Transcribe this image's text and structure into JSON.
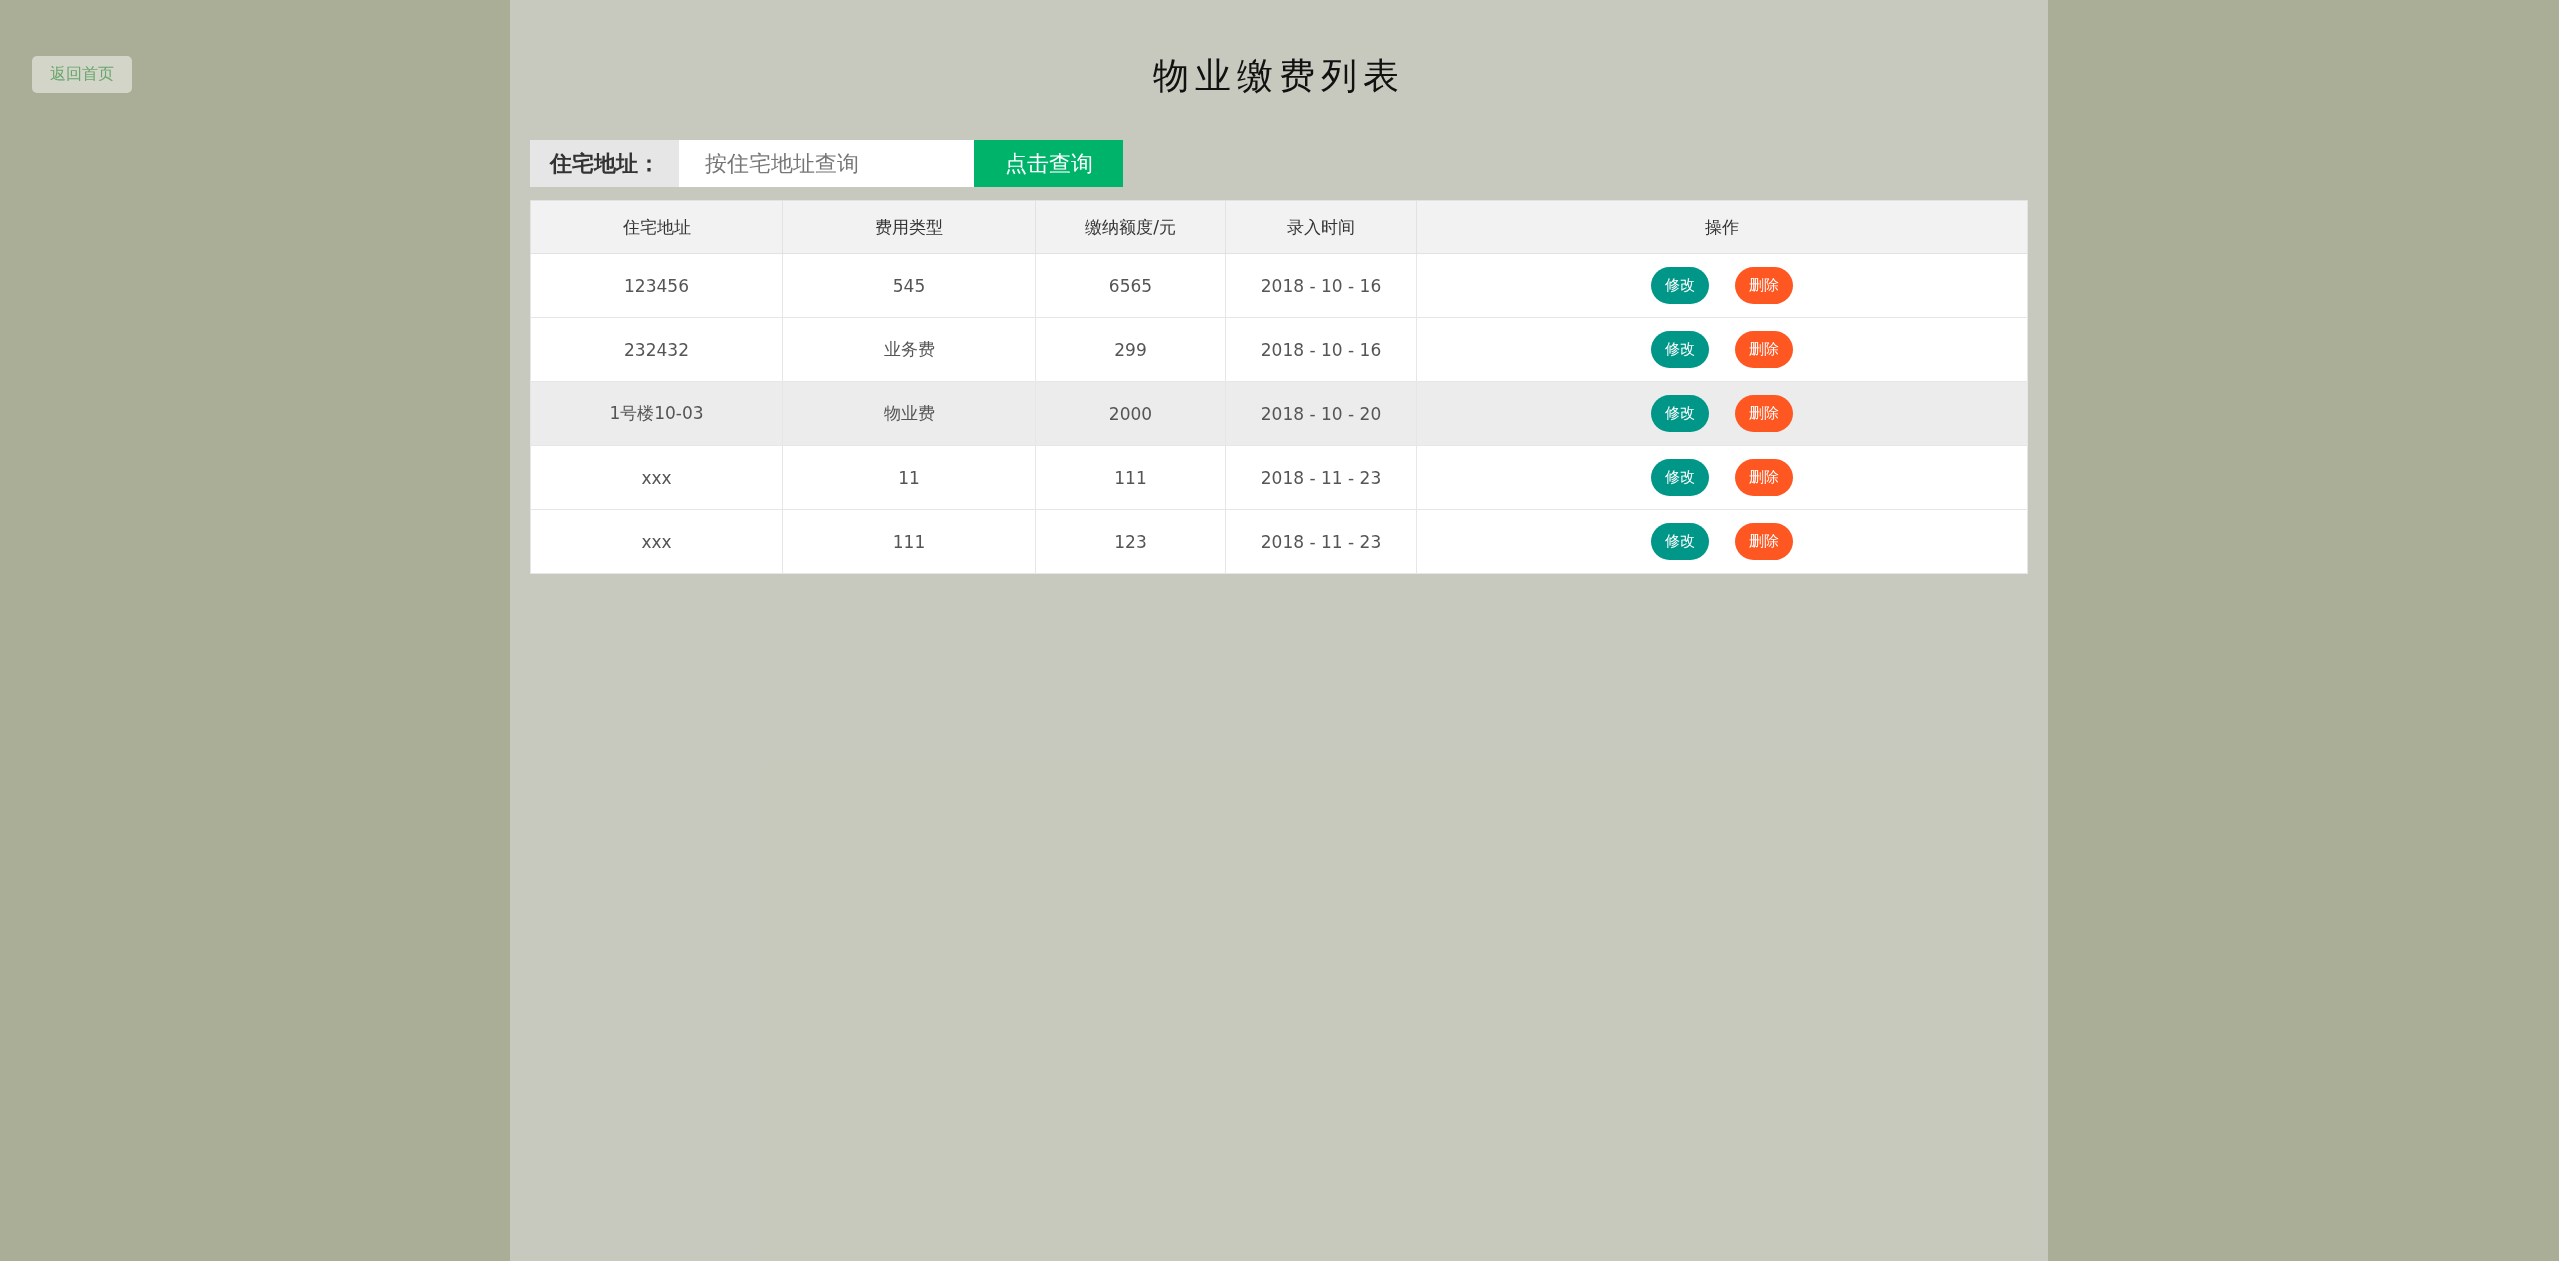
{
  "back_button": {
    "label": "返回首页"
  },
  "title": "物业缴费列表",
  "search": {
    "label": "住宅地址：",
    "placeholder": "按住宅地址查询",
    "button": "点击查询"
  },
  "table": {
    "columns": [
      "住宅地址",
      "费用类型",
      "缴纳额度/元",
      "录入时间",
      "操作"
    ],
    "rows": [
      {
        "cells": [
          "123456",
          "545",
          "6565",
          "2018 - 10 - 16"
        ],
        "actions": [
          "修改",
          "删除"
        ],
        "highlighted": false
      },
      {
        "cells": [
          "232432",
          "业务费",
          "299",
          "2018 - 10 - 16"
        ],
        "actions": [
          "修改",
          "删除"
        ],
        "highlighted": false
      },
      {
        "cells": [
          "1号楼10-03",
          "物业费",
          "2000",
          "2018 - 10 - 20"
        ],
        "actions": [
          "修改",
          "删除"
        ],
        "highlighted": true
      },
      {
        "cells": [
          "xxx",
          "11",
          "111",
          "2018 - 11 - 23"
        ],
        "actions": [
          "修改",
          "删除"
        ],
        "highlighted": false
      },
      {
        "cells": [
          "xxx",
          "111",
          "123",
          "2018 - 11 - 23"
        ],
        "actions": [
          "修改",
          "删除"
        ],
        "highlighted": false
      }
    ]
  }
}
